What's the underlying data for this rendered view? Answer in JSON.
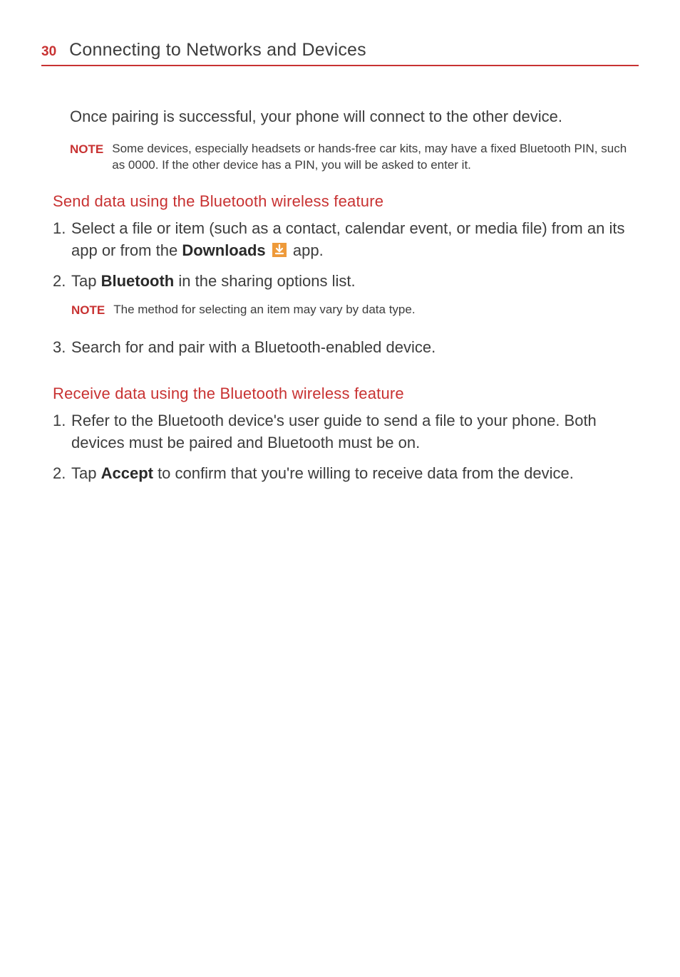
{
  "header": {
    "page_number": "30",
    "title": "Connecting to Networks and Devices"
  },
  "intro": "Once pairing is successful, your phone will connect to the other device.",
  "note1": {
    "label": "NOTE",
    "text": "Some devices, especially headsets or hands-free car kits, may have a fixed Bluetooth PIN, such as 0000. If the other device has a PIN, you will be asked to enter it."
  },
  "section1": {
    "heading": "Send data using the Bluetooth wireless feature",
    "item1_num": "1.",
    "item1_pre": "Select a file or item (such as a contact, calendar event, or media file) from an its app or from the ",
    "item1_bold": "Downloads",
    "item1_post": " app.",
    "item2_num": "2.",
    "item2_pre": "Tap ",
    "item2_bold": "Bluetooth",
    "item2_post": " in the sharing options list.",
    "note2_label": "NOTE",
    "note2_text": "The method for selecting an item may vary by data type.",
    "item3_num": "3.",
    "item3_text": "Search for and pair with a Bluetooth-enabled device."
  },
  "section2": {
    "heading": "Receive data using the Bluetooth wireless feature",
    "item1_num": "1.",
    "item1_text": "Refer to the Bluetooth device's user guide to send a file to your phone. Both devices must be paired and Bluetooth must be on.",
    "item2_num": "2.",
    "item2_pre": "Tap ",
    "item2_bold": "Accept",
    "item2_post": " to confirm that you're willing to receive data from the device."
  }
}
